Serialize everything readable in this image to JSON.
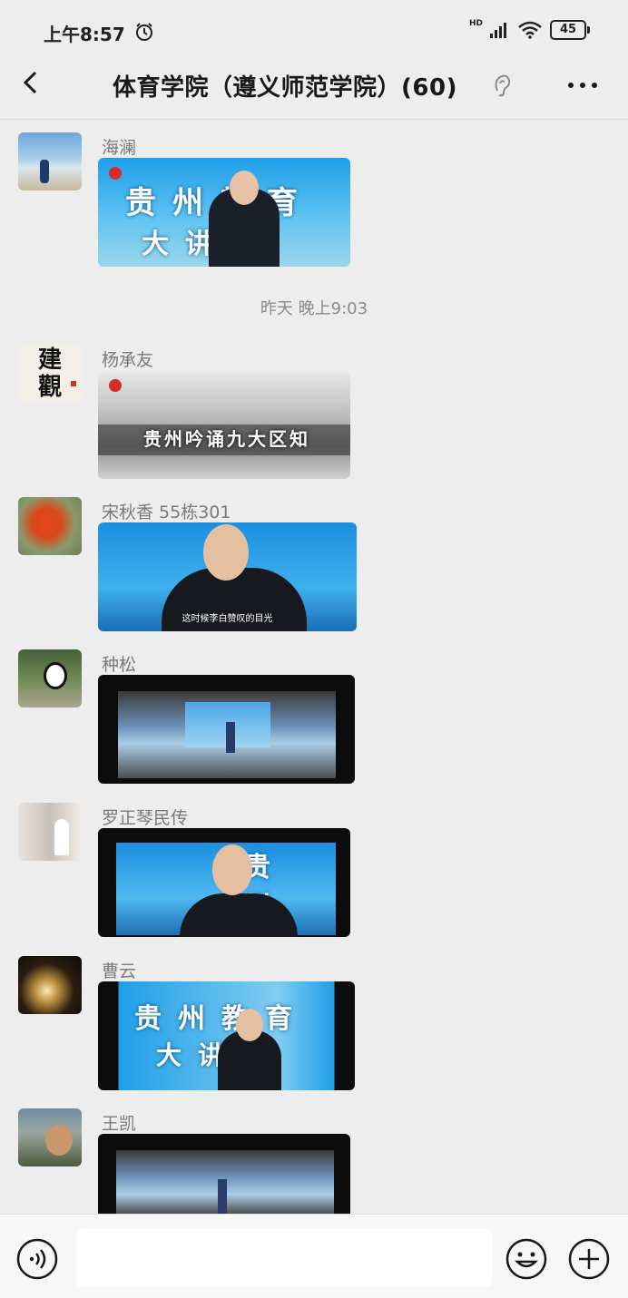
{
  "status_bar": {
    "time": "上午8:57",
    "network": "HD",
    "battery": "45"
  },
  "header": {
    "title": "体育学院（遵义师范学院）(60)"
  },
  "messages": [
    {
      "sender": "海澜",
      "video_title": "贵州教育",
      "video_title2": "大讲"
    },
    {
      "sender": "杨承友",
      "avatar_text": "建觀",
      "video_title": "贵州吟诵九大区知"
    },
    {
      "sender": "宋秋香  55栋301",
      "video_caption": "这时候李白赞叹的目光"
    },
    {
      "sender": "种松"
    },
    {
      "sender": "罗正琴民传",
      "video_title": "贵 州"
    },
    {
      "sender": "曹云",
      "video_title": "贵州教育",
      "video_title2": "大讲"
    },
    {
      "sender": "王凯"
    }
  ],
  "timestamp": "昨天 晚上9:03",
  "input": {
    "placeholder": ""
  }
}
